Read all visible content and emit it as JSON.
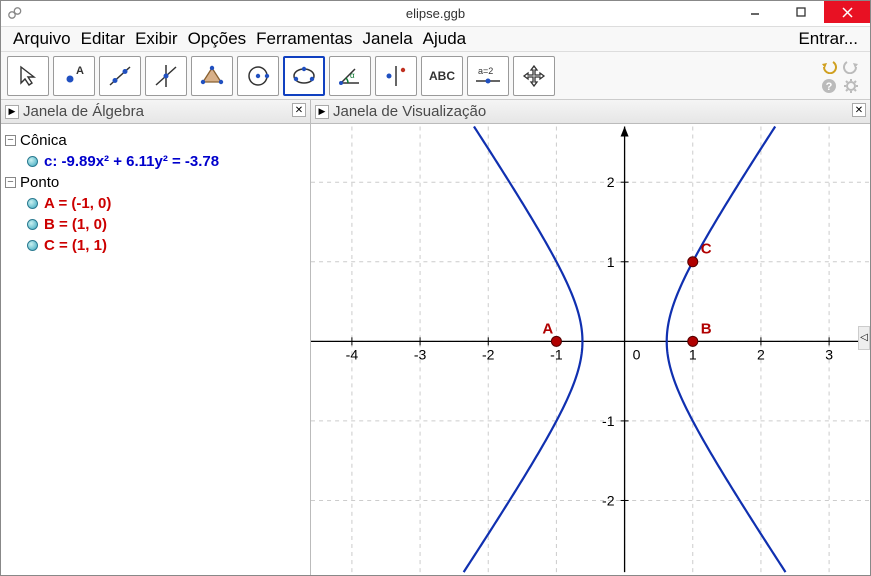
{
  "window": {
    "title": "elipse.ggb"
  },
  "menubar": {
    "items": [
      "Arquivo",
      "Editar",
      "Exibir",
      "Opções",
      "Ferramentas",
      "Janela",
      "Ajuda"
    ],
    "login": "Entrar..."
  },
  "toolbar": {
    "tools": [
      {
        "name": "move-tool",
        "selected": false
      },
      {
        "name": "point-tool",
        "selected": false
      },
      {
        "name": "line-tool",
        "selected": false
      },
      {
        "name": "perpendicular-tool",
        "selected": false
      },
      {
        "name": "polygon-tool",
        "selected": false
      },
      {
        "name": "circle-tool",
        "selected": false
      },
      {
        "name": "conic-tool",
        "selected": true
      },
      {
        "name": "angle-tool",
        "selected": false
      },
      {
        "name": "reflect-tool",
        "selected": false
      },
      {
        "name": "text-tool",
        "selected": false,
        "label": "ABC"
      },
      {
        "name": "slider-tool",
        "selected": false,
        "label": "a=2"
      },
      {
        "name": "move-view-tool",
        "selected": false
      }
    ]
  },
  "panels": {
    "algebra": {
      "title": "Janela de Álgebra"
    },
    "graphics": {
      "title": "Janela de Visualização"
    }
  },
  "algebra": {
    "categories": [
      {
        "name": "Cônica",
        "items": [
          {
            "kind": "conic",
            "label": "c: -9.89x² + 6.11y² = -3.78"
          }
        ]
      },
      {
        "name": "Ponto",
        "items": [
          {
            "kind": "point",
            "label": "A = (-1, 0)"
          },
          {
            "kind": "point",
            "label": "B = (1, 0)"
          },
          {
            "kind": "point",
            "label": "C = (1, 1)"
          }
        ]
      }
    ]
  },
  "chart_data": {
    "type": "conic-plot",
    "title": "",
    "xlabel": "",
    "ylabel": "",
    "xlim": [
      -4.6,
      3.6
    ],
    "ylim": [
      -2.9,
      2.7
    ],
    "x_ticks": [
      -4,
      -3,
      -2,
      -1,
      0,
      1,
      2,
      3
    ],
    "x_tick_labels": [
      "-4",
      "-3",
      "-2",
      "-1",
      "0",
      "1",
      "2",
      "3"
    ],
    "y_ticks": [
      -2,
      -1,
      1,
      2
    ],
    "y_tick_labels": [
      "-2",
      "-1",
      "1",
      "2"
    ],
    "origin_label": "0",
    "grid": true,
    "conic": {
      "name": "c",
      "equation_coeffs": {
        "xx": -9.89,
        "yy": 6.11,
        "rhs": -3.78
      },
      "type": "hyperbola",
      "a2": 0.382,
      "b2": 0.619,
      "color": "#1030b0"
    },
    "points": [
      {
        "name": "A",
        "x": -1,
        "y": 0,
        "color": "#b00000"
      },
      {
        "name": "B",
        "x": 1,
        "y": 0,
        "color": "#b00000"
      },
      {
        "name": "C",
        "x": 1,
        "y": 1,
        "color": "#b00000"
      }
    ]
  }
}
